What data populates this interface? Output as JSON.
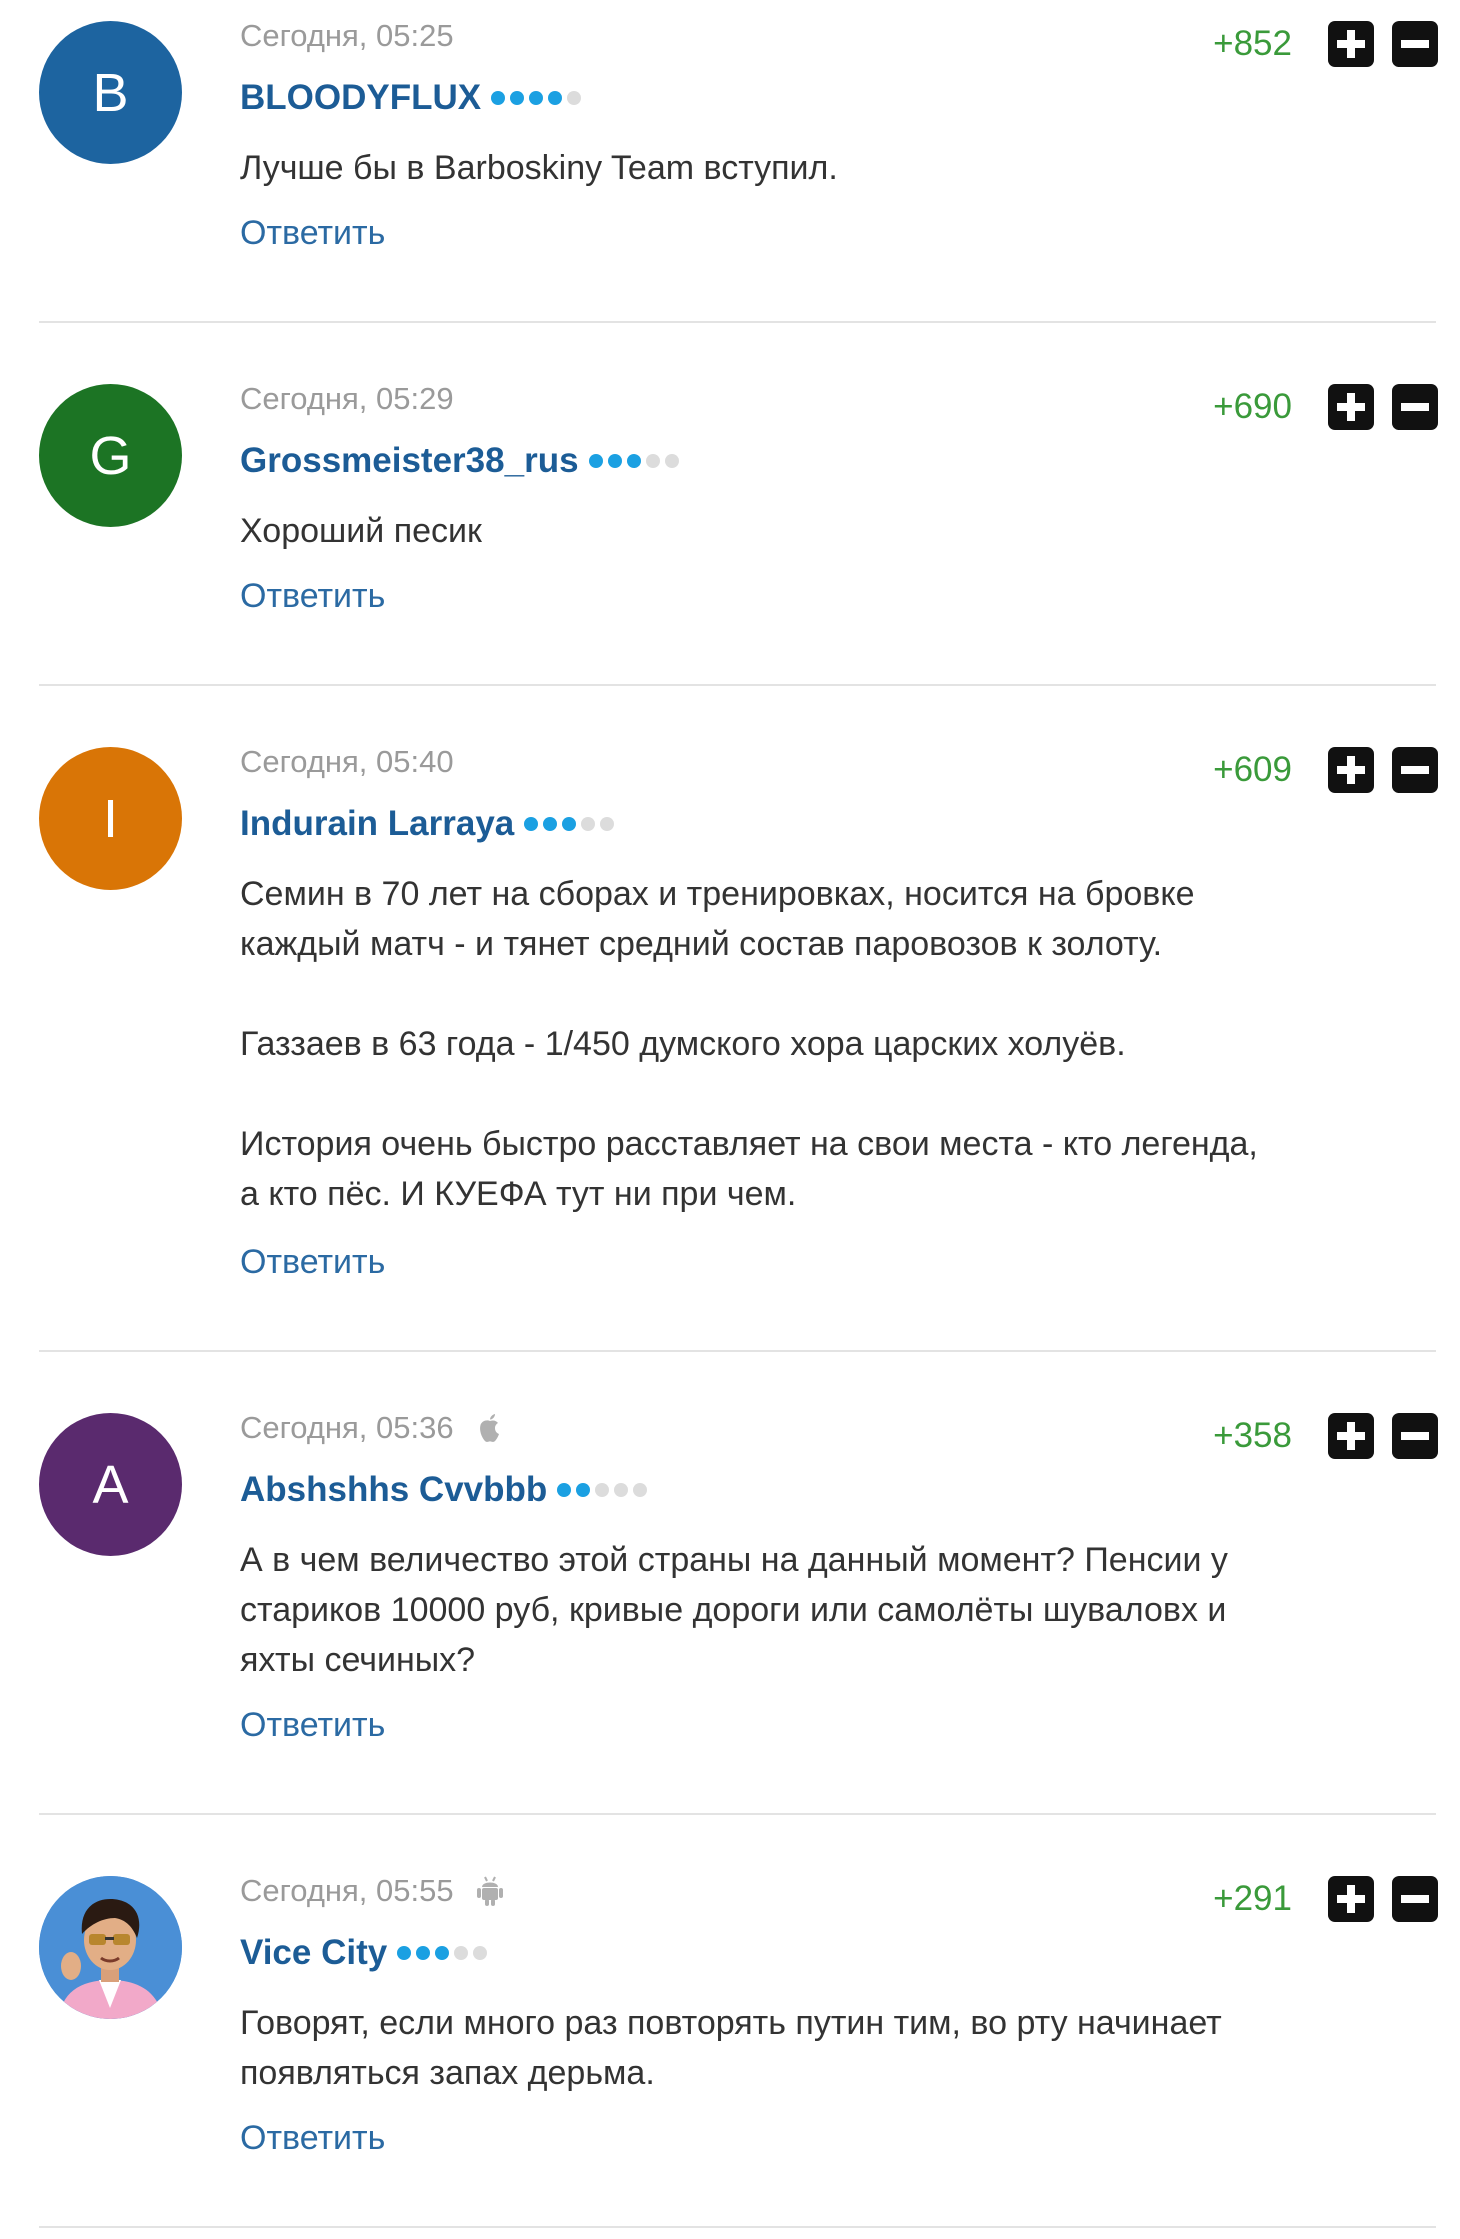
{
  "reply_label": "Ответить",
  "comments": [
    {
      "avatar_letter": "B",
      "avatar_color": "#1d64a0",
      "time": "Сегодня, 05:25",
      "device": "",
      "author": "BLOODYFLUX",
      "rank_level": 4,
      "score": "+852",
      "paragraphs": [
        "Лучше бы в Barboskiny Team вступил."
      ]
    },
    {
      "avatar_letter": "G",
      "avatar_color": "#1c7424",
      "time": "Сегодня, 05:29",
      "device": "",
      "author": "Grossmeister38_rus",
      "rank_level": 3,
      "score": "+690",
      "paragraphs": [
        "Хороший песик"
      ]
    },
    {
      "avatar_letter": "I",
      "avatar_color": "#d97506",
      "time": "Сегодня, 05:40",
      "device": "",
      "author": "Indurain Larraya",
      "rank_level": 3,
      "score": "+609",
      "paragraphs": [
        "Семин в 70 лет на сборах и тренировках, носится на бровке\nкаждый матч - и тянет средний состав паровозов к золоту.",
        "Газзаев в 63 года - 1/450 думского хора царских холуёв.",
        "История очень быстро расставляет на свои места - кто легенда,\nа кто пёс. И КУЕФА тут ни при чем."
      ]
    },
    {
      "avatar_letter": "A",
      "avatar_color": "#5a2a6e",
      "time": "Сегодня, 05:36",
      "device": "apple-icon",
      "author": "Abshshhs Cvvbbb",
      "rank_level": 2,
      "score": "+358",
      "paragraphs": [
        "А в чем величество этой страны на данный момент? Пенсии у\nстариков 10000 руб, кривые дороги или самолёты шуваловх и\nяхты сечиных?"
      ]
    },
    {
      "avatar_letter": "",
      "avatar_color": "#4a8fd6",
      "time": "Сегодня, 05:55",
      "device": "android-icon",
      "author": "Vice City",
      "rank_level": 3,
      "score": "+291",
      "paragraphs": [
        "Говорят, если много раз повторять путин тим, во рту начинает\nпоявляться запах дерьма."
      ]
    }
  ]
}
